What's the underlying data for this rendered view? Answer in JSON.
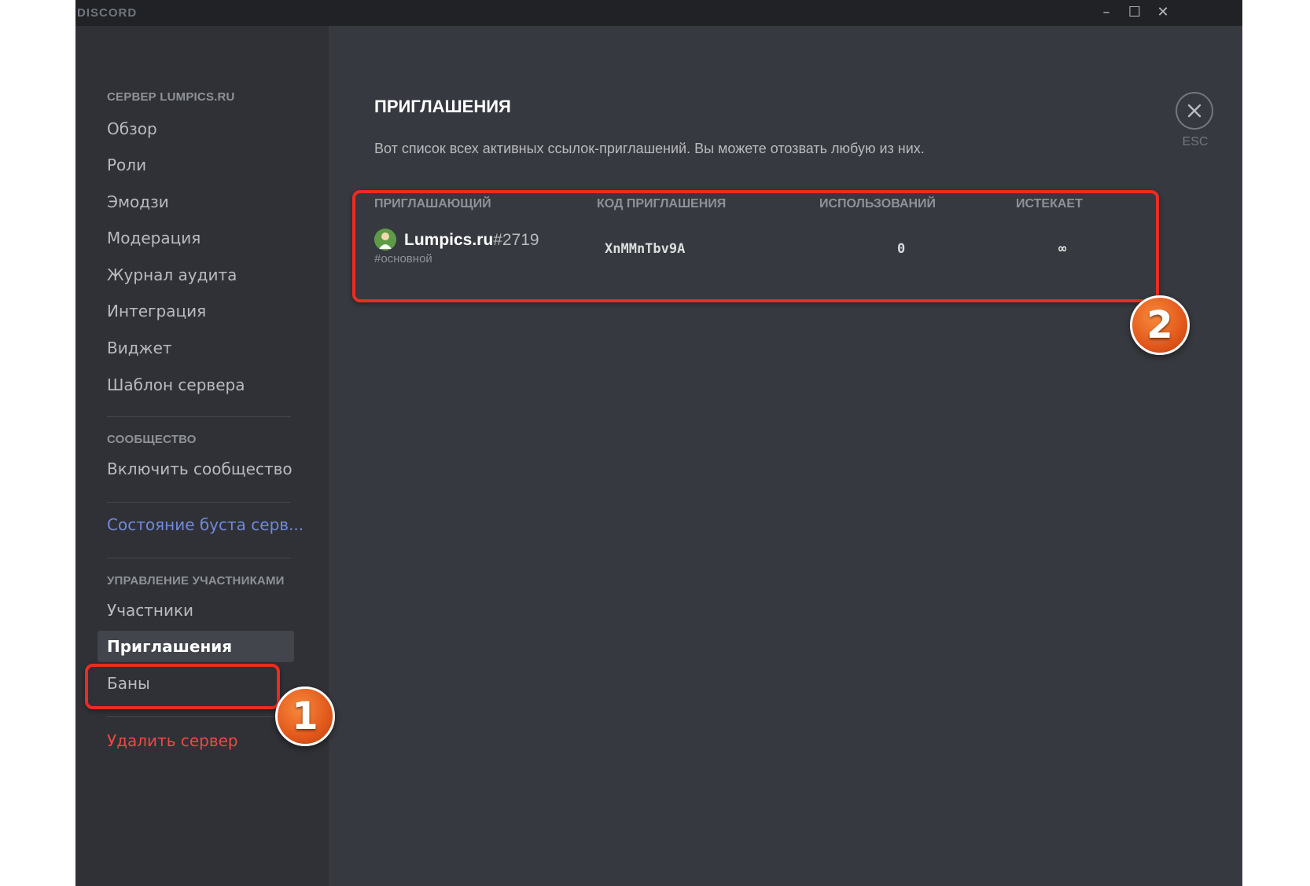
{
  "window": {
    "app_title": "DISCORD",
    "controls": {
      "minimize": "–",
      "maximize": "☐",
      "close": "✕"
    }
  },
  "sidebar": {
    "server_header": "СЕРВЕР LUMPICS.RU",
    "server_items": [
      "Обзор",
      "Роли",
      "Эмодзи",
      "Модерация",
      "Журнал аудита",
      "Интеграция",
      "Виджет",
      "Шаблон сервера"
    ],
    "community_header": "СООБЩЕСТВО",
    "community_items": [
      "Включить сообщество"
    ],
    "boost_item": "Состояние буста серв...",
    "members_header": "УПРАВЛЕНИЕ УЧАСТНИКАМИ",
    "members_items": [
      "Участники",
      "Приглашения",
      "Баны"
    ],
    "active_item": "Приглашения",
    "delete_item": "Удалить сервер"
  },
  "main": {
    "title": "ПРИГЛАШЕНИЯ",
    "description": "Вот список всех активных ссылок-приглашений. Вы можете отозвать любую из них.",
    "close_label": "ESC",
    "table": {
      "headers": [
        "ПРИГЛАШАЮЩИЙ",
        "КОД ПРИГЛАШЕНИЯ",
        "ИСПОЛЬЗОВАНИЙ",
        "ИСТЕКАЕТ"
      ],
      "rows": [
        {
          "inviter_name": "Lumpics.ru",
          "inviter_discriminator": "#2719",
          "channel": "#основной",
          "code": "XnMMnTbv9A",
          "uses": "0",
          "expires": "∞"
        }
      ]
    }
  },
  "annotations": {
    "step1": "1",
    "step2": "2",
    "highlight_color": "#ec2b21",
    "badge_color": "#e2581b"
  },
  "colors": {
    "sidebar_bg": "#2f3136",
    "main_bg": "#36393f",
    "titlebar_bg": "#202225",
    "boost": "#7289da",
    "danger": "#f04747"
  },
  "icons": {
    "close": "close-icon",
    "avatar": "user-avatar"
  }
}
